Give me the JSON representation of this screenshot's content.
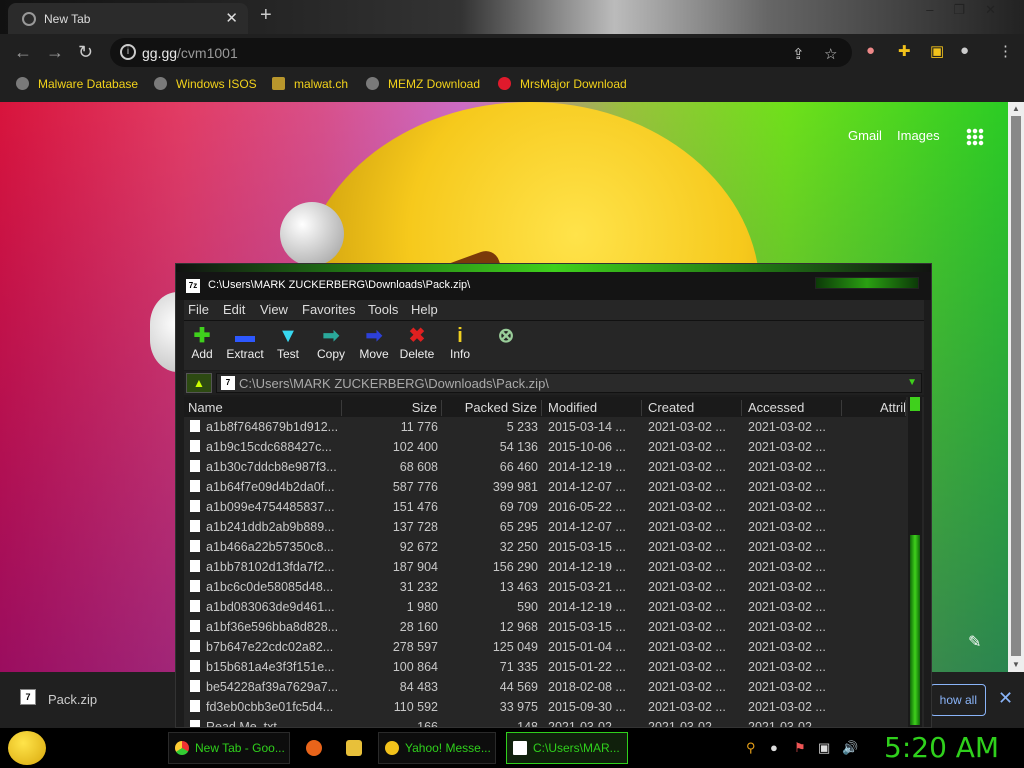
{
  "browser": {
    "tab_title": "New Tab",
    "url_host": "gg.gg",
    "url_path": "/cvm1001",
    "bookmarks": [
      "Malware Database",
      "Windows ISOS",
      "malwat.ch",
      "MEMZ Download",
      "MrsMajor Download"
    ]
  },
  "newtab": {
    "gmail": "Gmail",
    "images": "Images"
  },
  "download": {
    "filename": "Pack.zip",
    "show_all": "how all"
  },
  "sevenzip": {
    "title": "C:\\Users\\MARK ZUCKERBERG\\Downloads\\Pack.zip\\",
    "menu": [
      "File",
      "Edit",
      "View",
      "Favorites",
      "Tools",
      "Help"
    ],
    "tools": [
      {
        "label": "Add",
        "glyph": "✚",
        "color": "#3fd01c"
      },
      {
        "label": "Extract",
        "glyph": "▬",
        "color": "#2d58ff"
      },
      {
        "label": "Test",
        "glyph": "▼",
        "color": "#38d8f0"
      },
      {
        "label": "Copy",
        "glyph": "➡",
        "color": "#2aa89a"
      },
      {
        "label": "Move",
        "glyph": "➡",
        "color": "#2d40d8"
      },
      {
        "label": "Delete",
        "glyph": "✖",
        "color": "#e02020"
      },
      {
        "label": "Info",
        "glyph": "i",
        "color": "#f0d020"
      }
    ],
    "address": "C:\\Users\\MARK ZUCKERBERG\\Downloads\\Pack.zip\\",
    "columns": [
      "Name",
      "Size",
      "Packed Size",
      "Modified",
      "Created",
      "Accessed",
      "Attril"
    ],
    "rows": [
      [
        "a1b8f7648679b1d912...",
        "11 776",
        "5 233",
        "2015-03-14 ...",
        "2021-03-02 ...",
        "2021-03-02 ..."
      ],
      [
        "a1b9c15cdc688427c...",
        "102 400",
        "54 136",
        "2015-10-06 ...",
        "2021-03-02 ...",
        "2021-03-02 ..."
      ],
      [
        "a1b30c7ddcb8e987f3...",
        "68 608",
        "66 460",
        "2014-12-19 ...",
        "2021-03-02 ...",
        "2021-03-02 ..."
      ],
      [
        "a1b64f7e09d4b2da0f...",
        "587 776",
        "399 981",
        "2014-12-07 ...",
        "2021-03-02 ...",
        "2021-03-02 ..."
      ],
      [
        "a1b099e4754485837...",
        "151 476",
        "69 709",
        "2016-05-22 ...",
        "2021-03-02 ...",
        "2021-03-02 ..."
      ],
      [
        "a1b241ddb2ab9b889...",
        "137 728",
        "65 295",
        "2014-12-07 ...",
        "2021-03-02 ...",
        "2021-03-02 ..."
      ],
      [
        "a1b466a22b57350c8...",
        "92 672",
        "32 250",
        "2015-03-15 ...",
        "2021-03-02 ...",
        "2021-03-02 ..."
      ],
      [
        "a1bb78102d13fda7f2...",
        "187 904",
        "156 290",
        "2014-12-19 ...",
        "2021-03-02 ...",
        "2021-03-02 ..."
      ],
      [
        "a1bc6c0de58085d48...",
        "31 232",
        "13 463",
        "2015-03-21 ...",
        "2021-03-02 ...",
        "2021-03-02 ..."
      ],
      [
        "a1bd083063de9d461...",
        "1 980",
        "590",
        "2014-12-19 ...",
        "2021-03-02 ...",
        "2021-03-02 ..."
      ],
      [
        "a1bf36e596bba8d828...",
        "28 160",
        "12 968",
        "2015-03-15 ...",
        "2021-03-02 ...",
        "2021-03-02 ..."
      ],
      [
        "b7b647e22cdc02a82...",
        "278 597",
        "125 049",
        "2015-01-04 ...",
        "2021-03-02 ...",
        "2021-03-02 ..."
      ],
      [
        "b15b681a4e3f3f151e...",
        "100 864",
        "71 335",
        "2015-01-22 ...",
        "2021-03-02 ...",
        "2021-03-02 ..."
      ],
      [
        "be54228af39a7629a7...",
        "84 483",
        "44 569",
        "2018-02-08 ...",
        "2021-03-02 ...",
        "2021-03-02 ..."
      ],
      [
        "fd3eb0cbb3e01fc5d4...",
        "110 592",
        "33 975",
        "2015-09-30 ...",
        "2021-03-02 ...",
        "2021-03-02 ..."
      ],
      [
        "Read Me .txt",
        "166",
        "148",
        "2021-03-02 ...",
        "2021-03-02 ...",
        "2021-03-02 ..."
      ]
    ]
  },
  "taskbar": {
    "items": [
      "New Tab - Goo...",
      "Yahoo! Messe...",
      "C:\\Users\\MAR..."
    ],
    "clock": "5:20 AM"
  }
}
